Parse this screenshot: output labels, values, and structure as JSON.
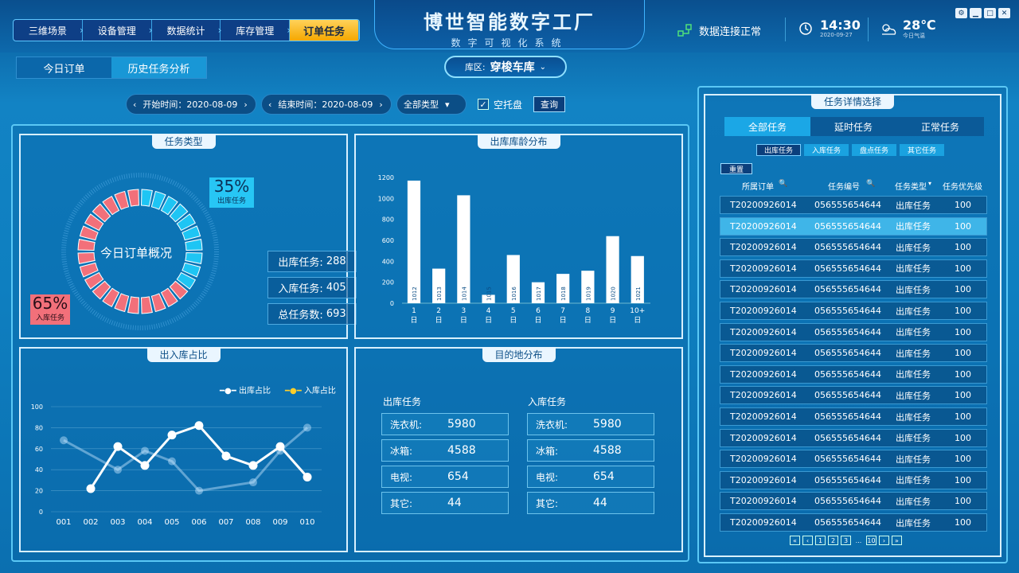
{
  "nav": {
    "items": [
      "三维场景",
      "设备管理",
      "数据统计",
      "库存管理",
      "订单任务"
    ],
    "active": 4
  },
  "title": {
    "main": "博世智能数字工厂",
    "sub": "数字可视化系统"
  },
  "status": {
    "connection": "数据连接正常",
    "time": "14:30",
    "date": "2020-09-27",
    "temp": "28℃",
    "temp_label": "今日气温"
  },
  "tabs": [
    "今日订单",
    "历史任务分析"
  ],
  "warehouse": {
    "label": "库区:",
    "value": "穿梭车库"
  },
  "filters": {
    "start": "开始时间：2020-08-09",
    "end": "结束时间：2020-08-09",
    "type": "全部类型",
    "checkbox": "空托盘",
    "query": "查询"
  },
  "task_type": {
    "title": "任务类型",
    "center": "今日订单概况",
    "out_pct": "35%",
    "out_label": "出库任务",
    "in_pct": "65%",
    "in_label": "入库任务",
    "stats": [
      {
        "label": "出库任务:",
        "value": "288"
      },
      {
        "label": "入库任务:",
        "value": "405"
      },
      {
        "label": "总任务数:",
        "value": "693"
      }
    ]
  },
  "age": {
    "title": "出库库龄分布",
    "ticks": [
      "0",
      "200",
      "400",
      "600",
      "800",
      "1000",
      "1200"
    ]
  },
  "ratio": {
    "title": "出入库占比",
    "legend_out": "出库占比",
    "legend_in": "入库占比"
  },
  "dest": {
    "title": "目的地分布",
    "out_title": "出库任务",
    "in_title": "入库任务",
    "out": [
      {
        "k": "洗衣机:",
        "v": "5980"
      },
      {
        "k": "冰箱:",
        "v": "4588"
      },
      {
        "k": "电视:",
        "v": "654"
      },
      {
        "k": "其它:",
        "v": "44"
      }
    ],
    "in": [
      {
        "k": "洗衣机:",
        "v": "5980"
      },
      {
        "k": "冰箱:",
        "v": "4588"
      },
      {
        "k": "电视:",
        "v": "654"
      },
      {
        "k": "其它:",
        "v": "44"
      }
    ]
  },
  "detail": {
    "title": "任务详情选择",
    "tabs": [
      "全部任务",
      "延时任务",
      "正常任务"
    ],
    "subtabs": [
      "出库任务",
      "入库任务",
      "盘点任务",
      "其它任务"
    ],
    "reset": "重置",
    "cols": [
      "所属订单",
      "任务编号",
      "任务类型",
      "任务优先级"
    ],
    "row": {
      "order": "T20200926014",
      "code": "056555654644",
      "type": "出库任务",
      "priority": "100"
    },
    "rows_count": 16,
    "selected": 1,
    "pager": [
      "«",
      "‹",
      "1",
      "2",
      "3",
      "...",
      "10",
      "›",
      "»"
    ]
  },
  "chart_data": [
    {
      "type": "bar",
      "title": "出库库龄分布",
      "categories": [
        "1日",
        "2日",
        "3日",
        "4日",
        "5日",
        "6日",
        "7日",
        "8日",
        "9日",
        "10+日"
      ],
      "bar_labels": [
        "1012",
        "1013",
        "1014",
        "1015",
        "1016",
        "1017",
        "1018",
        "1019",
        "1020",
        "1021"
      ],
      "values": [
        1170,
        330,
        1030,
        80,
        460,
        200,
        280,
        310,
        640,
        450
      ],
      "ylim": [
        0,
        1200
      ]
    },
    {
      "type": "line",
      "title": "出入库占比",
      "x": [
        "001",
        "002",
        "003",
        "004",
        "005",
        "006",
        "007",
        "008",
        "009",
        "010"
      ],
      "ylim": [
        0,
        100
      ],
      "series": [
        {
          "name": "出库占比",
          "values": [
            null,
            22,
            62,
            44,
            73,
            82,
            53,
            44,
            62,
            33
          ]
        },
        {
          "name": "入库占比",
          "values": [
            68,
            null,
            40,
            58,
            48,
            20,
            null,
            28,
            58,
            80
          ]
        }
      ]
    }
  ]
}
